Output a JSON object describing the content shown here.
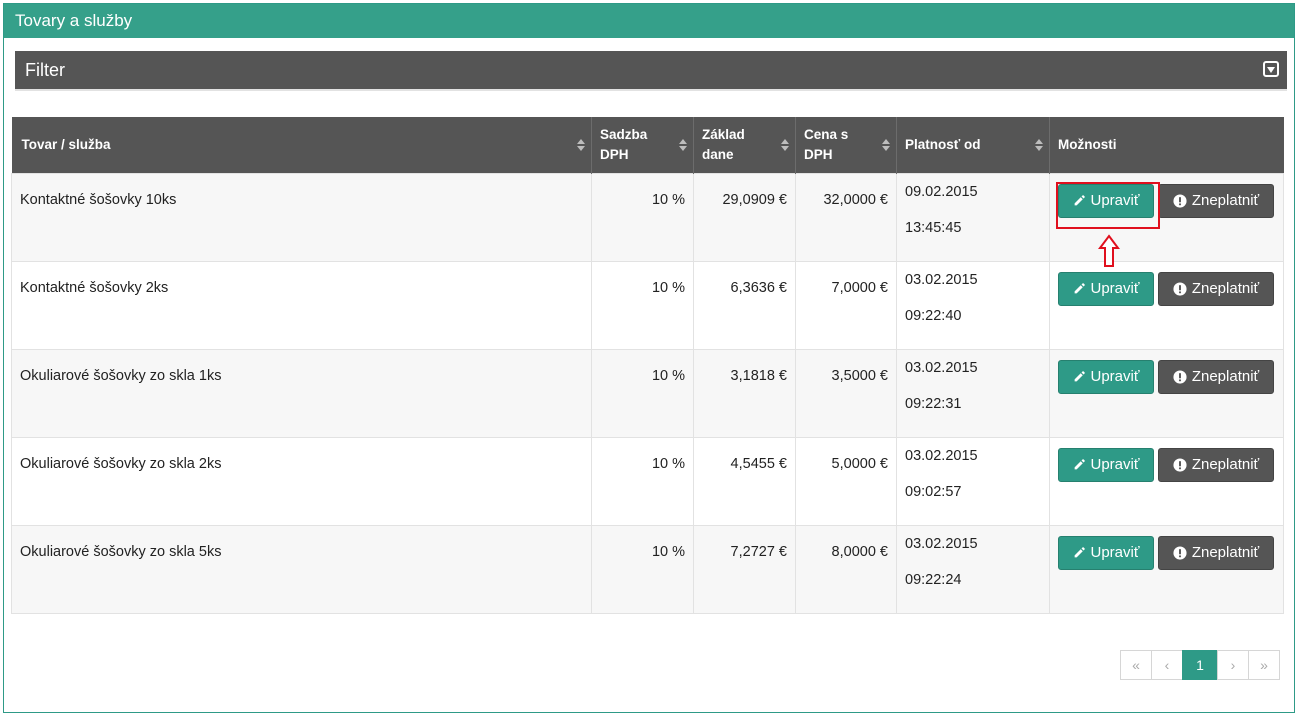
{
  "panel": {
    "title": "Tovary a služby"
  },
  "filter": {
    "label": "Filter"
  },
  "table": {
    "headers": {
      "product": "Tovar / služba",
      "vat_rate_1": "Sadzba",
      "vat_rate_2": "DPH",
      "base_1": "Základ",
      "base_2": "dane",
      "price_1": "Cena s",
      "price_2": "DPH",
      "valid_from": "Platnosť od",
      "options": "Možnosti"
    },
    "rows": [
      {
        "name": "Kontaktné šošovky 10ks",
        "vat": "10 %",
        "base": "29,0909 €",
        "price": "32,0000 €",
        "date": "09.02.2015",
        "time": "13:45:45"
      },
      {
        "name": "Kontaktné šošovky 2ks",
        "vat": "10 %",
        "base": "6,3636 €",
        "price": "7,0000 €",
        "date": "03.02.2015",
        "time": "09:22:40"
      },
      {
        "name": "Okuliarové šošovky zo skla 1ks",
        "vat": "10 %",
        "base": "3,1818 €",
        "price": "3,5000 €",
        "date": "03.02.2015",
        "time": "09:22:31"
      },
      {
        "name": "Okuliarové šošovky zo skla 2ks",
        "vat": "10 %",
        "base": "4,5455 €",
        "price": "5,0000 €",
        "date": "03.02.2015",
        "time": "09:02:57"
      },
      {
        "name": "Okuliarové šošovky zo skla 5ks",
        "vat": "10 %",
        "base": "7,2727 €",
        "price": "8,0000 €",
        "date": "03.02.2015",
        "time": "09:22:24"
      }
    ]
  },
  "buttons": {
    "edit": "Upraviť",
    "invalidate": "Zneplatniť"
  },
  "pagination": {
    "first": "«",
    "prev": "‹",
    "current": "1",
    "next": "›",
    "last": "»"
  },
  "icons": {
    "edit": "pencil-icon",
    "invalidate": "exclamation-circle-icon",
    "filter_toggle": "caret-down-square-icon",
    "annotation": "arrow-up-outline-icon"
  },
  "colors": {
    "accent": "#35a08a",
    "header_dark": "#555555",
    "highlight": "#e0101e"
  }
}
